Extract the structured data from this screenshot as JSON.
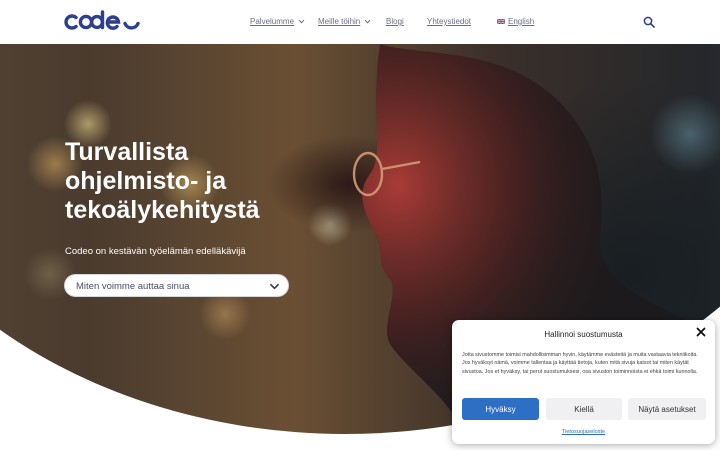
{
  "header": {
    "logo_text": "codeo",
    "nav": [
      {
        "label": "Palvelumme",
        "has_dropdown": true
      },
      {
        "label": "Meille töihin",
        "has_dropdown": true
      },
      {
        "label": "Blogi",
        "has_dropdown": false
      },
      {
        "label": "Yhteystiedot",
        "has_dropdown": false
      },
      {
        "label": "English",
        "has_dropdown": false,
        "icon": "uk-flag-icon"
      }
    ],
    "search_icon": "search-icon"
  },
  "hero": {
    "title": "Turvallista ohjelmisto- ja tekoälykehitystä",
    "subtitle": "Codeo on kestävän työelämän edelläkävijä",
    "select_placeholder": "Miten voimme auttaa sinua"
  },
  "consent": {
    "title": "Hallinnoi suostumusta",
    "text": "Jotta sivustomme toimisi mahdollisimman hyvin, käytämme evästeitä ja muita vastaavia tekniikoita. Jos hyväksyt nämä, voimme tallentaa ja käyttää tietoja, kuten mitä sivuja katsot tai miten käytät sivustoa. Jos et hyväksy, tai perut suostumuksesi, osa sivuston toiminnoista ei ehkä toimi kunnolla.",
    "accept_label": "Hyväksy",
    "deny_label": "Kiellä",
    "preferences_label": "Näytä asetukset",
    "privacy_link": "Tietosuojaseloste"
  },
  "colors": {
    "brand": "#2e3f8f",
    "nav_text": "#6b6e86",
    "accept_button": "#2c6fc5",
    "secondary_button": "#f0f0f3"
  }
}
